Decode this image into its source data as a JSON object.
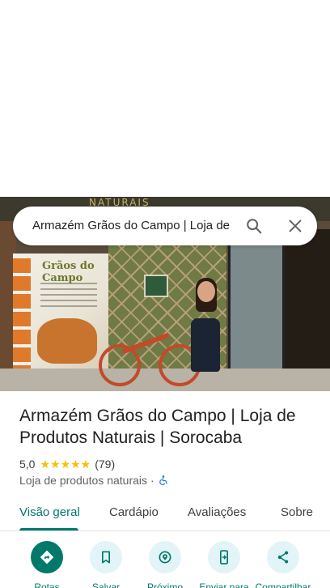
{
  "search": {
    "query": "Armazém Grãos do Campo | Loja de"
  },
  "place": {
    "title": "Armazém Grãos do Campo | Loja de Produtos Naturais | Sorocaba",
    "rating": "5,0",
    "stars": "★★★★★",
    "reviews": "(79)",
    "category": "Loja de produtos naturais",
    "separator": "·"
  },
  "photo": {
    "banner_text": "NATURAIS",
    "poster_title": "Grãos do Campo"
  },
  "tabs": [
    {
      "label": "Visão geral",
      "active": true
    },
    {
      "label": "Cardápio",
      "active": false
    },
    {
      "label": "Avaliações",
      "active": false
    },
    {
      "label": "Sobre",
      "active": false
    }
  ],
  "actions": [
    {
      "label": "Rotas",
      "icon": "directions-icon"
    },
    {
      "label": "Salvar",
      "icon": "bookmark-icon"
    },
    {
      "label": "Próximo",
      "icon": "nearby-icon"
    },
    {
      "label": "Enviar para",
      "icon": "send-to-phone-icon"
    },
    {
      "label": "Compartilhar",
      "icon": "share-icon"
    }
  ],
  "colors": {
    "accent": "#00796b",
    "action_bg": "#e2f4f8",
    "star": "#fbbc04"
  }
}
